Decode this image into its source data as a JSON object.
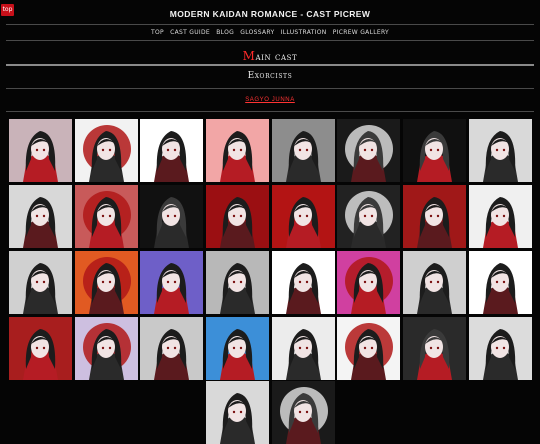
{
  "top_button": "top",
  "site_title": "MODERN KAIDAN ROMANCE - CAST PICREW",
  "nav": [
    "TOP",
    "CAST GUIDE",
    "BLOG",
    "GLOSSARY",
    "ILLUSTRATION",
    "PICREW GALLERY"
  ],
  "sections": {
    "main_first": "M",
    "main_rest": "ain cast",
    "exorcists": "Exorcists",
    "subsection": "SAGYO JUNNA"
  },
  "thumb_count": 32,
  "colors": {
    "accent_red": "#ff2a2a",
    "background": "#050505",
    "thumb_backgrounds": [
      "#c9b3b9",
      "#f2f2f2",
      "#ffffff",
      "#f2a6a6",
      "#8d8d8d",
      "#1a1a1a",
      "#101010",
      "#d9d9d9",
      "#d8d8d8",
      "#c85a5a",
      "#111111",
      "#9b0f12",
      "#b31414",
      "#222222",
      "#a01818",
      "#f0f0f0",
      "#d0d0d0",
      "#e15a22",
      "#6e5fc8",
      "#b8b8b8",
      "#ffffff",
      "#d040a0",
      "#cfcfcf",
      "#ffffff",
      "#a81e1e",
      "#cdbfe0",
      "#c9c9c9",
      "#3c8fd8",
      "#ececec",
      "#f4f4f4",
      "#2a2a2a",
      "#dcdcdc"
    ]
  }
}
